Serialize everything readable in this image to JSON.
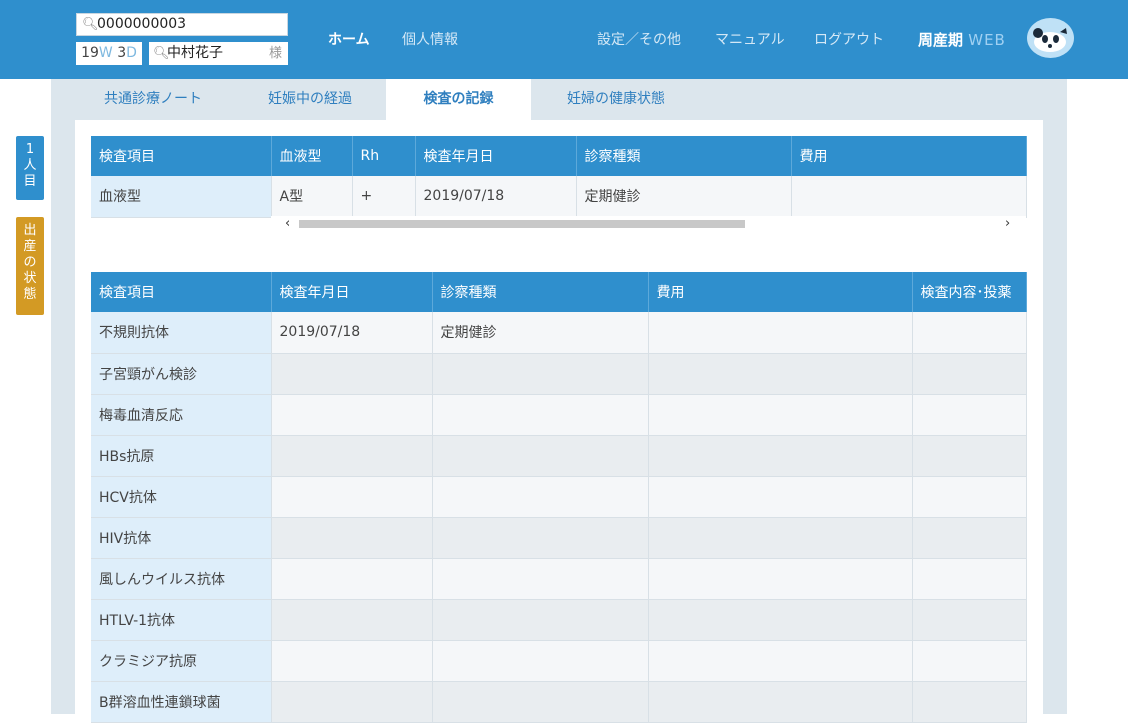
{
  "header": {
    "search_value": "0000000003",
    "weeks": "19",
    "weeks_unit": "W",
    "days": "3",
    "days_unit": "D",
    "patient_name": "中村花子",
    "name_suffix": "様",
    "nav": {
      "home": "ホーム",
      "personal": "個人情報",
      "settings": "設定／その他",
      "manual": "マニュアル",
      "logout": "ログアウト"
    },
    "brand_main": "周産期",
    "brand_web": "WEB"
  },
  "side_tabs": {
    "first": "1人目",
    "birth": "出産の状態"
  },
  "tabs": [
    {
      "label": "共通診療ノート"
    },
    {
      "label": "妊娠中の経過"
    },
    {
      "label": "検査の記録"
    },
    {
      "label": "妊婦の健康状態"
    }
  ],
  "blood_table": {
    "headers": [
      "検査項目",
      "血液型",
      "Rh",
      "検査年月日",
      "診察種類",
      "費用"
    ],
    "row": [
      "血液型",
      "A型",
      "+",
      "2019/07/18",
      "定期健診",
      ""
    ]
  },
  "tests_table": {
    "headers": [
      "検査項目",
      "検査年月日",
      "診察種類",
      "費用",
      "検査内容･投薬"
    ],
    "rows": [
      [
        "不規則抗体",
        "2019/07/18",
        "定期健診",
        "",
        ""
      ],
      [
        "子宮頸がん検診",
        "",
        "",
        "",
        ""
      ],
      [
        "梅毒血清反応",
        "",
        "",
        "",
        ""
      ],
      [
        "HBs抗原",
        "",
        "",
        "",
        ""
      ],
      [
        "HCV抗体",
        "",
        "",
        "",
        ""
      ],
      [
        "HIV抗体",
        "",
        "",
        "",
        ""
      ],
      [
        "風しんウイルス抗体",
        "",
        "",
        "",
        ""
      ],
      [
        "HTLV-1抗体",
        "",
        "",
        "",
        ""
      ],
      [
        "クラミジア抗原",
        "",
        "",
        "",
        ""
      ],
      [
        "B群溶血性連鎖球菌",
        "",
        "",
        "",
        ""
      ]
    ]
  },
  "colors": {
    "header_bg": "#2f8fcd",
    "frame_bg": "#dce6ed",
    "side_tab_blue": "#2f8fcd",
    "side_tab_gold": "#d39a24"
  },
  "icons": {
    "search": "search-icon",
    "scroll_left": "chevron-left-icon",
    "scroll_right": "chevron-right-icon",
    "logo": "panda-logo"
  }
}
